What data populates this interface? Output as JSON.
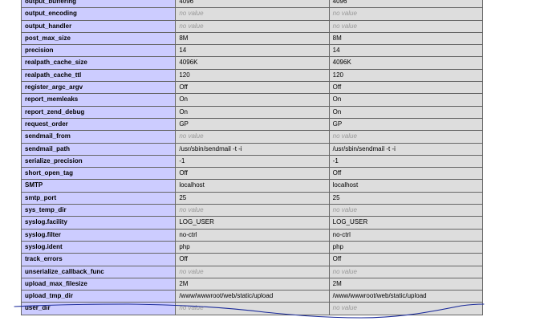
{
  "phpinfo": {
    "rows": [
      {
        "directive": "output_buffering",
        "local": "4096",
        "master": "4096"
      },
      {
        "directive": "output_encoding",
        "local": "no value",
        "master": "no value"
      },
      {
        "directive": "output_handler",
        "local": "no value",
        "master": "no value"
      },
      {
        "directive": "post_max_size",
        "local": "8M",
        "master": "8M"
      },
      {
        "directive": "precision",
        "local": "14",
        "master": "14"
      },
      {
        "directive": "realpath_cache_size",
        "local": "4096K",
        "master": "4096K"
      },
      {
        "directive": "realpath_cache_ttl",
        "local": "120",
        "master": "120"
      },
      {
        "directive": "register_argc_argv",
        "local": "Off",
        "master": "Off"
      },
      {
        "directive": "report_memleaks",
        "local": "On",
        "master": "On"
      },
      {
        "directive": "report_zend_debug",
        "local": "On",
        "master": "On"
      },
      {
        "directive": "request_order",
        "local": "GP",
        "master": "GP"
      },
      {
        "directive": "sendmail_from",
        "local": "no value",
        "master": "no value"
      },
      {
        "directive": "sendmail_path",
        "local": "/usr/sbin/sendmail -t -i",
        "master": "/usr/sbin/sendmail -t -i"
      },
      {
        "directive": "serialize_precision",
        "local": "-1",
        "master": "-1"
      },
      {
        "directive": "short_open_tag",
        "local": "Off",
        "master": "Off"
      },
      {
        "directive": "SMTP",
        "local": "localhost",
        "master": "localhost"
      },
      {
        "directive": "smtp_port",
        "local": "25",
        "master": "25"
      },
      {
        "directive": "sys_temp_dir",
        "local": "no value",
        "master": "no value"
      },
      {
        "directive": "syslog.facility",
        "local": "LOG_USER",
        "master": "LOG_USER"
      },
      {
        "directive": "syslog.filter",
        "local": "no-ctrl",
        "master": "no-ctrl"
      },
      {
        "directive": "syslog.ident",
        "local": "php",
        "master": "php"
      },
      {
        "directive": "track_errors",
        "local": "Off",
        "master": "Off"
      },
      {
        "directive": "unserialize_callback_func",
        "local": "no value",
        "master": "no value"
      },
      {
        "directive": "upload_max_filesize",
        "local": "2M",
        "master": "2M"
      },
      {
        "directive": "upload_tmp_dir",
        "local": "/www/wwwroot/web/static/upload",
        "master": "/www/wwwroot/web/static/upload"
      },
      {
        "directive": "user_dir",
        "local": "no value",
        "master": "no value"
      }
    ]
  },
  "colors": {
    "directive_bg": "#ccccff",
    "value_bg": "#dddddd",
    "no_value_text": "#999999",
    "annotation_ink": "#1a2a9a"
  }
}
